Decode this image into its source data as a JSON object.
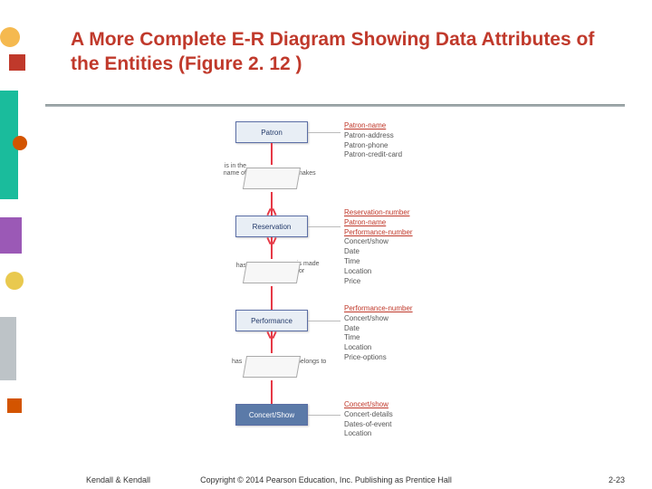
{
  "title": "A More Complete E-R Diagram Showing Data Attributes of the Entities (Figure 2. 12 )",
  "entities": {
    "patron": "Patron",
    "reservation": "Reservation",
    "performance": "Performance",
    "concert": "Concert/Show"
  },
  "relationships": {
    "r1_left": "is in the name of",
    "r1_right": "makes",
    "r2_left": "has",
    "r2_right": "is made for",
    "r3_left": "has",
    "r3_right": "belongs to"
  },
  "attributes": {
    "patron": {
      "key": "Patron-name",
      "rest": [
        "Patron-address",
        "Patron-phone",
        "Patron-credit-card"
      ]
    },
    "reservation": {
      "keys": [
        "Reservation-number",
        "Patron-name",
        "Performance-number"
      ],
      "rest": [
        "Concert/show",
        "Date",
        "Time",
        "Location",
        "Price"
      ]
    },
    "performance": {
      "key": "Performance-number",
      "rest": [
        "Concert/show",
        "Date",
        "Time",
        "Location",
        "Price-options"
      ]
    },
    "concert": {
      "key": "Concert/show",
      "rest": [
        "Concert-details",
        "Dates-of-event",
        "Location"
      ]
    }
  },
  "footer": {
    "left": "Kendall & Kendall",
    "center": "Copyright © 2014 Pearson Education, Inc. Publishing as Prentice Hall",
    "right": "2-23"
  }
}
